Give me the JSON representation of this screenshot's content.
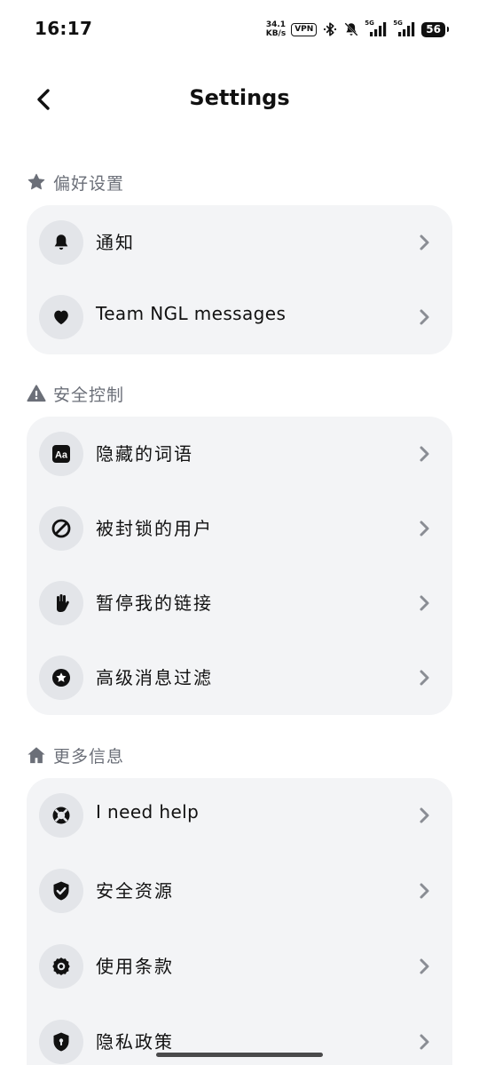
{
  "status_bar": {
    "time": "16:17",
    "net_speed_value": "34.1",
    "net_speed_unit": "KB/s",
    "vpn": "VPN",
    "sig1_label": "5G",
    "sig2_label": "5G",
    "battery": "56"
  },
  "header": {
    "title": "Settings",
    "back_icon": "chevron-left-icon"
  },
  "sections": {
    "preferences": {
      "label": "偏好设置",
      "icon": "star-icon",
      "items": [
        {
          "label": "通知",
          "icon": "bell-icon"
        },
        {
          "label": "Team NGL messages",
          "icon": "heart-icon"
        }
      ]
    },
    "safety": {
      "label": "安全控制",
      "icon": "warning-icon",
      "items": [
        {
          "label": "隐藏的词语",
          "icon": "font-aa-icon"
        },
        {
          "label": "被封锁的用户",
          "icon": "block-icon"
        },
        {
          "label": "暂停我的链接",
          "icon": "hand-icon"
        },
        {
          "label": "高级消息过滤",
          "icon": "star-badge-icon"
        }
      ]
    },
    "more": {
      "label": "更多信息",
      "icon": "home-icon",
      "items": [
        {
          "label": "I need help",
          "icon": "lifebuoy-icon"
        },
        {
          "label": "安全资源",
          "icon": "shield-check-icon"
        },
        {
          "label": "使用条款",
          "icon": "police-badge-icon"
        },
        {
          "label": "隐私政策",
          "icon": "shield-lock-icon"
        }
      ]
    }
  },
  "colors": {
    "card_bg": "#f3f4f6",
    "icon_circle_bg": "#e3e5e9",
    "section_label": "#6b6f78",
    "chevron": "#8a8d94"
  }
}
